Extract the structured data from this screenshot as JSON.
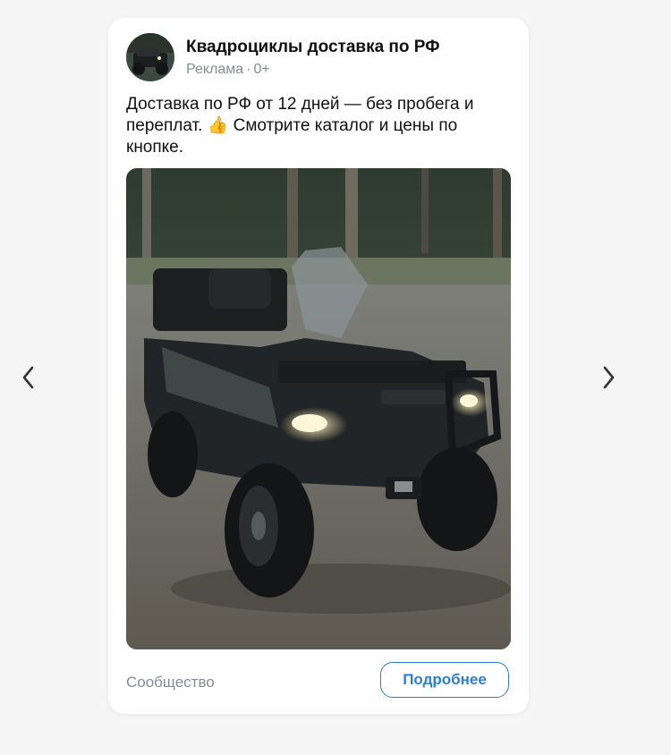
{
  "ad": {
    "title": "Квадроциклы доставка по РФ",
    "label": "Реклама",
    "separator": "·",
    "age_rating": "0+",
    "text": "Доставка по РФ от 12 дней — без пробега и переплат. 👍 Смотрите каталог и цены по кнопке.",
    "footer_label": "Сообщество",
    "cta_label": "Подробнее"
  },
  "navigation": {
    "prev_icon": "chevron-left-icon",
    "next_icon": "chevron-right-icon"
  },
  "colors": {
    "accent": "#2a7fd4",
    "secondary_text": "#818c99",
    "background": "#f5f5f5"
  }
}
